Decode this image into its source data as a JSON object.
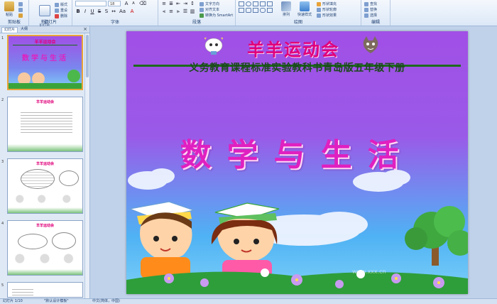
{
  "ribbon": {
    "groups": [
      {
        "label": "剪贴板"
      },
      {
        "label": "幻灯片"
      },
      {
        "label": "字体"
      },
      {
        "label": "段落"
      },
      {
        "label": "绘图"
      },
      {
        "label": "编辑"
      }
    ],
    "paste_label": "粘贴",
    "new_slide_label": "新建\n幻灯片",
    "layout_label": "版式",
    "reset_label": "重设",
    "delete_label": "删除",
    "font_size": "18",
    "text_direction_label": "文字方向",
    "align_text_label": "对齐文本",
    "smartart_label": "转换为 SmartArt",
    "arrange_label": "排列",
    "quick_styles_label": "快速样式",
    "shape_fill_label": "形状填充",
    "shape_outline_label": "形状轮廓",
    "shape_effects_label": "形状效果",
    "find_label": "查找",
    "replace_label": "替换",
    "select_label": "选择"
  },
  "panel": {
    "tab_slides": "幻灯片",
    "tab_outline": "大纲",
    "thumbs": [
      {
        "num": "1",
        "title": "羊羊运动会",
        "big": "数学与生活"
      },
      {
        "num": "2",
        "title": "羊羊运动会"
      },
      {
        "num": "3",
        "title": "羊羊运动会"
      },
      {
        "num": "4",
        "title": "羊羊运动会"
      },
      {
        "num": "5",
        "title": ""
      }
    ]
  },
  "slide": {
    "title": "羊羊运动会",
    "subtitle": "义务教育课程标准实验教科书青岛版五年级下册",
    "main_text": "数学与生活",
    "watermark": "www.xxx.cn"
  },
  "status": {
    "slide_info": "幻灯片 1/10",
    "theme": "\"默认设计模板\"",
    "language": "中文(简体，中国)"
  },
  "colors": {
    "title": "#e0007a",
    "subtitle": "#1a4a1a",
    "main_text": "#e020c0",
    "slide_top": "#a14fe6"
  }
}
